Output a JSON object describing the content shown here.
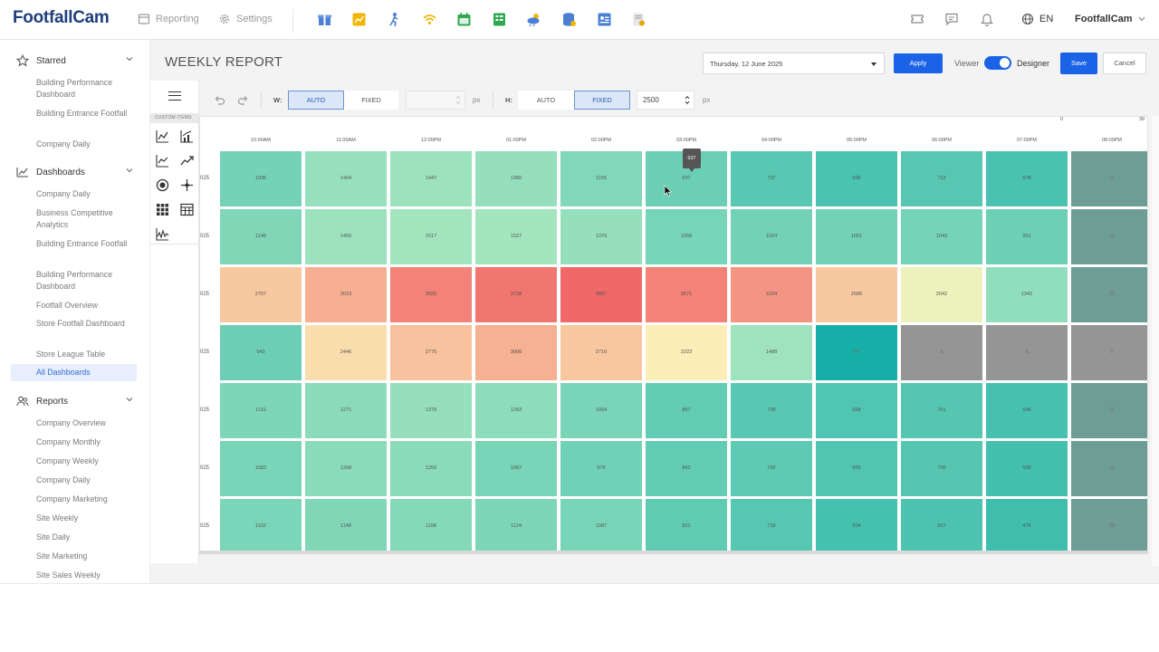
{
  "app": {
    "logo": "FootfallCam"
  },
  "topnav": [
    {
      "label": "Reporting",
      "icon": "window-icon"
    },
    {
      "label": "Settings",
      "icon": "gear-icon"
    }
  ],
  "app_icons": [
    {
      "name": "gift-app-icon",
      "color": "#4a7fd4"
    },
    {
      "name": "chart-app-icon",
      "color": "#f2b500"
    },
    {
      "name": "walker-app-icon",
      "color": "#4a7fd4"
    },
    {
      "name": "wifi-app-icon",
      "color": "#f2b500"
    },
    {
      "name": "calendar-app-icon",
      "color": "#2fa84f"
    },
    {
      "name": "sheet-app-icon",
      "color": "#2fa84f"
    },
    {
      "name": "weather-app-icon",
      "color": "#4a7fd4"
    },
    {
      "name": "database-app-icon",
      "color": "#4a7fd4"
    },
    {
      "name": "id-card-app-icon",
      "color": "#4a7fd4"
    },
    {
      "name": "report-app-icon",
      "color": "#e8a300"
    }
  ],
  "topright": {
    "language": "EN",
    "account": "FootfallCam"
  },
  "sidebar": {
    "starred": {
      "label": "Starred",
      "items": [
        "Building Performance Dashboard",
        "Building Entrance Footfall",
        "Company Daily"
      ]
    },
    "dashboards": {
      "label": "Dashboards",
      "items": [
        "Company Daily",
        "Business Competitive Analytics",
        "Building Entrance Footfall",
        "Building Performance Dashboard",
        "Footfall Overview",
        "Store Footfall Dashboard",
        "Store League Table",
        "All Dashboards"
      ],
      "active": "All Dashboards"
    },
    "reports": {
      "label": "Reports",
      "items": [
        "Company Overview",
        "Company Monthly",
        "Company Weekly",
        "Company Daily",
        "Company Marketing",
        "Site Weekly",
        "Site Daily",
        "Site Marketing",
        "Site Sales Weekly"
      ]
    }
  },
  "page": {
    "title": "WEEKLY REPORT",
    "date": "Thursday, 12 June 2025",
    "apply": "Apply",
    "viewer": "Viewer",
    "designer": "Designer",
    "designer_on": true,
    "save": "Save",
    "cancel": "Cancel"
  },
  "toolbox": {
    "caption": "CUSTOM ITEMS",
    "icons": [
      "line-chart-icon",
      "bar-line-chart-icon",
      "area-chart-icon",
      "trend-chart-icon",
      "gauge-icon",
      "crosshair-icon",
      "grid-icon",
      "table-icon",
      "waveform-chart-icon"
    ]
  },
  "sizing": {
    "w_label": "W:",
    "w_auto": "AUTO",
    "w_fixed": "FIXED",
    "w_mode": "AUTO",
    "w_unit": "px",
    "h_label": "H:",
    "h_auto": "AUTO",
    "h_fixed": "FIXED",
    "h_mode": "FIXED",
    "h_value": "2500",
    "h_unit": "px"
  },
  "chart_data": {
    "type": "heatmap",
    "columns": [
      "10:00AM",
      "11:00AM",
      "12:00PM",
      "01:00PM",
      "02:00PM",
      "03:00PM",
      "04:00PM",
      "05:00PM",
      "06:00PM",
      "07:00PM",
      "08:00PM"
    ],
    "row_labels": [
      "025",
      "025",
      "025",
      "025",
      "025",
      "025",
      "025"
    ],
    "values": [
      [
        1036,
        1404,
        1447,
        1380,
        1155,
        937,
        737,
        595,
        723,
        578,
        11
      ],
      [
        1146,
        1455,
        1517,
        1527,
        1379,
        1058,
        1024,
        1001,
        1043,
        951,
        12
      ],
      [
        2707,
        3019,
        3555,
        3728,
        3897,
        3571,
        3334,
        2686,
        2042,
        1342,
        23
      ],
      [
        943,
        2446,
        2775,
        3006,
        2716,
        2223,
        1488,
        44,
        0,
        0,
        0
      ],
      [
        1131,
        1271,
        1379,
        1293,
        1094,
        857,
        738,
        658,
        701,
        548,
        10
      ],
      [
        1082,
        1268,
        1250,
        1087,
        979,
        842,
        792,
        669,
        705,
        528,
        12
      ],
      [
        1102,
        1148,
        1198,
        1124,
        1087,
        821,
        716,
        534,
        627,
        475,
        25
      ]
    ],
    "scale_labels": [
      "0",
      "39"
    ],
    "tooltip": "937",
    "colors": {
      "low": "#12ada6",
      "mid": "#fbf5bb",
      "high": "#f16868",
      "zero": "#959595",
      "dim_last_col": "#6e9d95"
    }
  }
}
